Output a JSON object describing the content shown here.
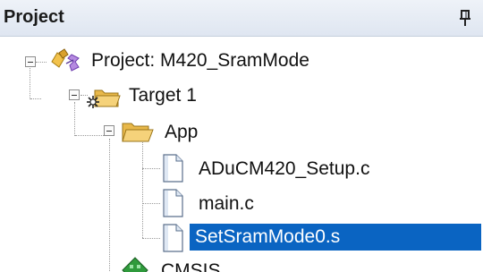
{
  "panel": {
    "title": "Project",
    "pin_icon": "pin-icon"
  },
  "tree": {
    "project": {
      "label": "Project: M420_SramMode",
      "icon": "project-icon",
      "expanded": true
    },
    "target": {
      "label": "Target 1",
      "icon": "target-folder-icon",
      "expanded": true
    },
    "group_app": {
      "label": "App",
      "icon": "folder-icon",
      "expanded": true
    },
    "files": [
      {
        "label": "ADuCM420_Setup.c",
        "icon": "file-icon",
        "selected": false
      },
      {
        "label": "main.c",
        "icon": "file-icon",
        "selected": false
      },
      {
        "label": "SetSramMode0.s",
        "icon": "file-icon",
        "selected": true
      }
    ],
    "component": {
      "label": "CMSIS",
      "icon": "component-icon"
    }
  },
  "colors": {
    "selection": "#0a64c2",
    "title_bar": "#e4eaf3",
    "folder": "#e8b84a"
  }
}
